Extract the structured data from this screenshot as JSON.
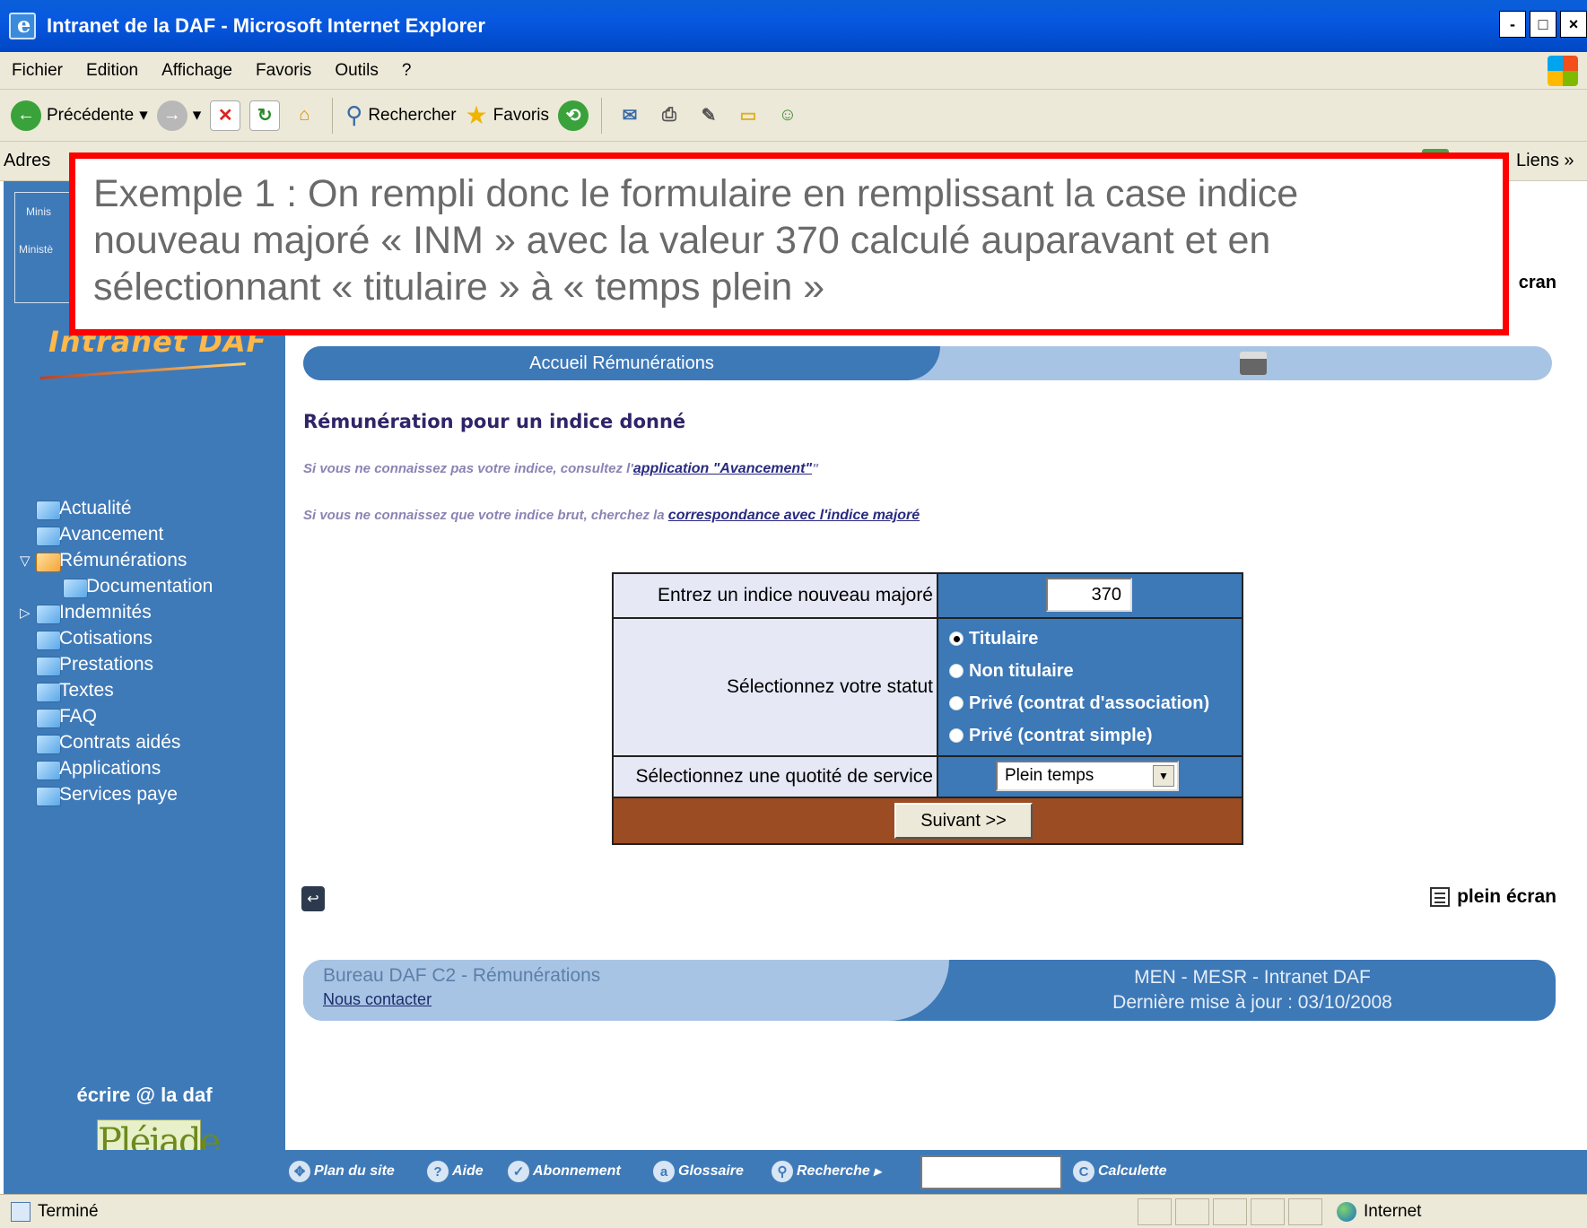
{
  "window": {
    "title": "Intranet de la DAF - Microsoft Internet Explorer",
    "buttons": [
      "-",
      "□",
      "×"
    ]
  },
  "menu": [
    "Fichier",
    "Edition",
    "Affichage",
    "Favoris",
    "Outils",
    "?"
  ],
  "toolbar": {
    "back_label": "Précédente",
    "search_label": "Rechercher",
    "favorites_label": "Favoris"
  },
  "addressbar": {
    "label": "Adres",
    "links_label": "Liens »"
  },
  "sidebar": {
    "ministry_top": "Minis",
    "ministry_bottom": "Ministè",
    "logo_text": "Intranet DAF",
    "nav": [
      {
        "label": "Actualité",
        "open": false,
        "indent": 0,
        "arrow": ""
      },
      {
        "label": "Avancement",
        "open": false,
        "indent": 0,
        "arrow": ""
      },
      {
        "label": "Rémunérations",
        "open": true,
        "indent": 0,
        "arrow": "▽"
      },
      {
        "label": "Documentation",
        "open": false,
        "indent": 1,
        "arrow": ""
      },
      {
        "label": "Indemnités",
        "open": false,
        "indent": 0,
        "arrow": "▷"
      },
      {
        "label": "Cotisations",
        "open": false,
        "indent": 0,
        "arrow": ""
      },
      {
        "label": "Prestations",
        "open": false,
        "indent": 0,
        "arrow": ""
      },
      {
        "label": "Textes",
        "open": false,
        "indent": 0,
        "arrow": ""
      },
      {
        "label": "FAQ",
        "open": false,
        "indent": 0,
        "arrow": ""
      },
      {
        "label": "Contrats aidés",
        "open": false,
        "indent": 0,
        "arrow": ""
      },
      {
        "label": "Applications",
        "open": false,
        "indent": 0,
        "arrow": ""
      },
      {
        "label": "Services paye",
        "open": false,
        "indent": 0,
        "arrow": ""
      }
    ],
    "ecrire": "écrire @ la daf",
    "pleiade": "Pléiade"
  },
  "main": {
    "plein_ecran_top": "cran",
    "breadcrumb_label": "Accueil Rémunérations",
    "title": "Rémunération pour un indice donné",
    "info1_prefix": "Si vous ne connaissez pas votre indice, consultez l'",
    "info1_link": "application \"Avancement\"",
    "info1_suffix": "\"",
    "info2_prefix": "Si vous ne connaissez que votre indice brut, cherchez la ",
    "info2_link": "correspondance avec l'indice majoré",
    "form": {
      "inm_label": "Entrez un indice nouveau majoré",
      "inm_value": "370",
      "statut_label": "Sélectionnez votre statut",
      "statut_options": [
        "Titulaire",
        "Non titulaire",
        "Privé (contrat d'association)",
        "Privé (contrat simple)"
      ],
      "statut_selected": "Titulaire",
      "quotite_label": "Sélectionnez une quotité de service",
      "quotite_value": "Plein temps",
      "submit_label": "Suivant >>"
    },
    "plein_ecran": "plein écran",
    "footer": {
      "left_title": "Bureau DAF C2 - Rémunérations",
      "contact_link": "Nous contacter",
      "right_line1": "MEN - MESR - Intranet DAF",
      "right_line2": "Dernière mise à jour : 03/10/2008"
    }
  },
  "bottom_links": [
    "Plan du site",
    "Aide",
    "Abonnement",
    "Glossaire",
    "Recherche",
    "Calculette"
  ],
  "status": {
    "text": "Terminé",
    "zone": "Internet"
  },
  "annotation": {
    "lines": [
      "Exemple 1 : On rempli donc le formulaire en remplissant la case indice",
      "nouveau majoré « INM » avec la valeur 370 calculé auparavant et en",
      "sélectionnant « titulaire » à « temps plein »"
    ],
    "border_color": "#ff0000"
  }
}
